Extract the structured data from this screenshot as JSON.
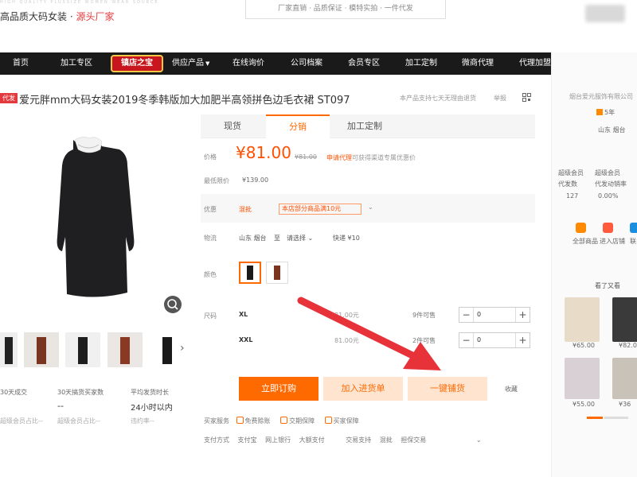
{
  "header": {
    "brand_prefix": "高品质大码女装 · ",
    "brand_highlight": "源头厂家",
    "faint_slogan": "HIGH QUALITY PLUSSIZE WOMEN WEAR SOURCE",
    "promise": "厂家直销 · 品质保证 · 模特实拍 · 一件代发"
  },
  "nav": {
    "items": [
      "首页",
      "加工专区",
      "供应产品",
      "在线询价",
      "公司档案",
      "会员专区",
      "加工定制",
      "微商代理",
      "代理加盟"
    ],
    "badge": "镇店之宝"
  },
  "product": {
    "tag": "代发",
    "title": "爱元胖mm大码女装2019冬季韩版加大加肥半高领拼色边毛衣裙 ST097",
    "note": "本产品支持七天无理由退货",
    "report": "举报"
  },
  "tabs": [
    "现货",
    "分销",
    "加工定制"
  ],
  "pricing": {
    "price_label": "价格",
    "price": "¥81.00",
    "price_old": "¥81.00",
    "apply_link": "申请代理",
    "apply_rest": "可获得渠道专属优惠价",
    "min_label": "最低限价",
    "min_value": "¥139.00"
  },
  "promo": {
    "label": "优惠",
    "tag1": "混批",
    "tag2": "本店部分商品满10元"
  },
  "shipping": {
    "label": "物流",
    "from": "山东 烟台",
    "to_word": "至",
    "select": "请选择",
    "express": "快递 ¥10"
  },
  "color": {
    "label": "颜色"
  },
  "sizes": {
    "label": "尺码",
    "rows": [
      {
        "name": "XL",
        "price": "81.00元",
        "stock": "9件可售",
        "qty": "0"
      },
      {
        "name": "XXL",
        "price": "81.00元",
        "stock": "2件可售",
        "qty": "0"
      }
    ]
  },
  "buttons": {
    "order": "立即订购",
    "cart": "加入进货单",
    "one_click": "一键铺货",
    "fav": "收藏"
  },
  "services": {
    "label": "买家服务",
    "items": [
      "免费赊账",
      "交期保障",
      "买家保障"
    ],
    "pay_label": "支付方式",
    "pay_items": [
      "支付宝",
      "网上银行",
      "大额支付"
    ],
    "trade_label": "交易支持",
    "trade_items": [
      "混批",
      "担保交易"
    ]
  },
  "stats": {
    "s1_label": "30天成交",
    "s2_label": "30天搞货买家数",
    "s2_value": "--",
    "s3_label": "平均发货时长",
    "s3_value": "24小时以内",
    "sub1": "超级会员占比--",
    "sub2": "超级会员占比--",
    "sub3": "违约率--"
  },
  "right_panel": {
    "company": "烟台爱元服饰有限公司",
    "years": "5年",
    "location": "山东 烟台",
    "m1_label": "超级会员",
    "m1_sub": "代发数",
    "m1_value": "127",
    "m2_label": "超级会员",
    "m2_sub": "代发动销率",
    "m2_value": "0.00%",
    "link1": "全部商品",
    "link2": "进入店铺",
    "link3": "联系",
    "also_view": "看了又看",
    "prices": [
      "¥65.00",
      "¥82.0",
      "¥55.00",
      "¥36"
    ]
  },
  "icons": {
    "zoom": "magnifier-icon",
    "grid": "qrcode-icon",
    "next": "chevron-right-icon"
  },
  "colors": {
    "accent": "#ff6a00",
    "price": "#ff5000",
    "nav_bg": "#1a1a1a",
    "arrow": "#e8323a"
  }
}
